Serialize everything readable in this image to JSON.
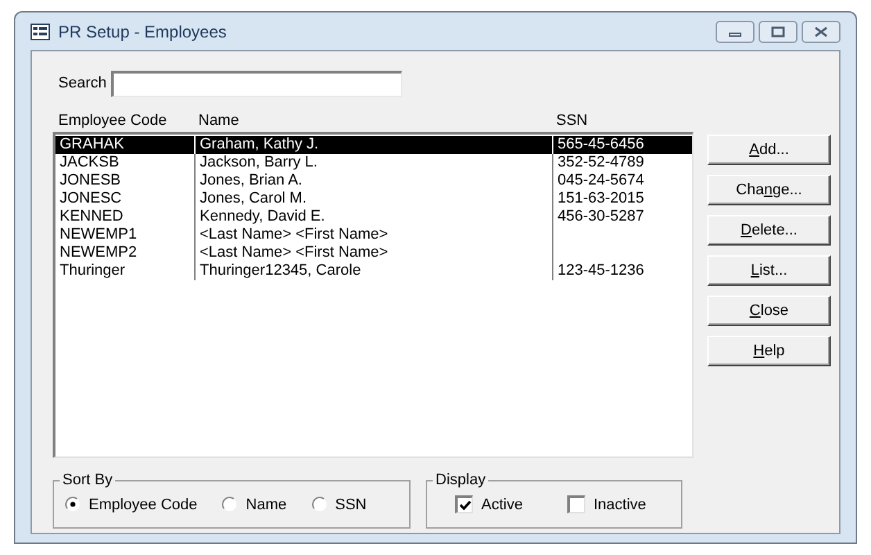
{
  "window": {
    "title": "PR Setup - Employees"
  },
  "search": {
    "label": "Search"
  },
  "table": {
    "columns": [
      "Employee Code",
      "Name",
      "SSN"
    ],
    "rows": [
      {
        "cells": [
          "GRAHAK",
          "Graham, Kathy J.",
          "565-45-6456"
        ],
        "selected": true
      },
      {
        "cells": [
          "JACKSB",
          "Jackson, Barry L.",
          "352-52-4789"
        ],
        "selected": false
      },
      {
        "cells": [
          "JONESB",
          "Jones, Brian A.",
          "045-24-5674"
        ],
        "selected": false
      },
      {
        "cells": [
          "JONESC",
          "Jones, Carol M.",
          "151-63-2015"
        ],
        "selected": false
      },
      {
        "cells": [
          "KENNED",
          "Kennedy, David E.",
          "456-30-5287"
        ],
        "selected": false
      },
      {
        "cells": [
          "NEWEMP1",
          "<Last Name> <First Name>",
          null
        ],
        "selected": false
      },
      {
        "cells": [
          "NEWEMP2",
          "<Last Name> <First Name>",
          null
        ],
        "selected": false
      },
      {
        "cells": [
          "Thuringer",
          "Thuringer12345, Carole",
          "123-45-1236"
        ],
        "selected": false
      }
    ]
  },
  "buttons": [
    {
      "key": "A",
      "post": "dd..."
    },
    {
      "pre": "Cha",
      "key": "n",
      "post": "ge..."
    },
    {
      "key": "D",
      "post": "elete..."
    },
    {
      "key": "L",
      "post": "ist..."
    },
    {
      "key": "C",
      "post": "lose"
    },
    {
      "key": "H",
      "post": "elp"
    }
  ],
  "sort_by": {
    "title": "Sort By",
    "options": [
      {
        "label": "Employee Code",
        "selected": true
      },
      {
        "label": "Name",
        "selected": false
      },
      {
        "label": "SSN",
        "selected": false
      }
    ]
  },
  "display": {
    "title": "Display",
    "options": [
      {
        "label": "Active",
        "checked": true
      },
      {
        "label": "Inactive",
        "checked": false
      }
    ]
  }
}
